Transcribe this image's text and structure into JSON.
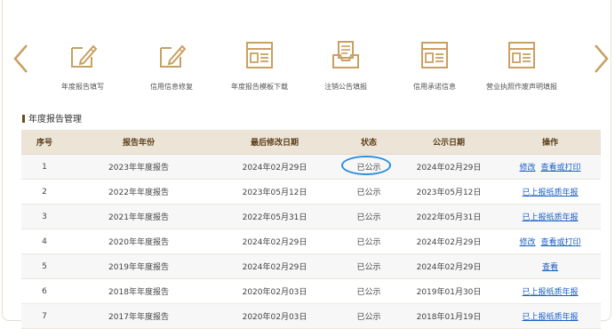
{
  "nav": {
    "prev_icon": "chevron-left-icon",
    "next_icon": "chevron-right-icon",
    "items": [
      {
        "label": "年度报告填写",
        "icon": "edit-form-icon"
      },
      {
        "label": "信用信息修复",
        "icon": "edit-form-icon"
      },
      {
        "label": "年度报告模板下载",
        "icon": "document-list-icon"
      },
      {
        "label": "注销公告填报",
        "icon": "inbox-document-icon"
      },
      {
        "label": "信用承诺信息",
        "icon": "document-list-icon"
      },
      {
        "label": "营业执照作废声明填报",
        "icon": "document-list-icon"
      }
    ]
  },
  "colors": {
    "accent": "#c9a062",
    "header_bg": "#ede4d8",
    "link": "#1a5fc4",
    "highlight": "#2b8de0"
  },
  "section": {
    "title": "年度报告管理"
  },
  "table": {
    "headers": [
      "序号",
      "报告年份",
      "最后修改日期",
      "状态",
      "公示日期",
      "操作"
    ],
    "rows": [
      {
        "no": "1",
        "year": "2023年年度报告",
        "modified": "2024年02月29日",
        "status": "已公示",
        "published": "2024年02月29日",
        "actions": [
          "修改",
          "查看或打印"
        ]
      },
      {
        "no": "2",
        "year": "2022年年度报告",
        "modified": "2023年05月12日",
        "status": "已公示",
        "published": "2023年05月12日",
        "actions": [
          "已上报纸质年报"
        ]
      },
      {
        "no": "3",
        "year": "2021年年度报告",
        "modified": "2022年05月31日",
        "status": "已公示",
        "published": "2022年05月31日",
        "actions": [
          "已上报纸质年报"
        ]
      },
      {
        "no": "4",
        "year": "2020年年度报告",
        "modified": "2024年02月29日",
        "status": "已公示",
        "published": "2024年02月29日",
        "actions": [
          "修改",
          "查看或打印"
        ]
      },
      {
        "no": "5",
        "year": "2019年年度报告",
        "modified": "2024年02月29日",
        "status": "已公示",
        "published": "2024年02月29日",
        "actions": [
          "查看"
        ]
      },
      {
        "no": "6",
        "year": "2018年年度报告",
        "modified": "2020年02月03日",
        "status": "已公示",
        "published": "2019年01月30日",
        "actions": [
          "已上报纸质年报"
        ]
      },
      {
        "no": "7",
        "year": "2017年年度报告",
        "modified": "2020年02月03日",
        "status": "已公示",
        "published": "2018年01月19日",
        "actions": [
          "已上报纸质年报"
        ]
      }
    ]
  }
}
